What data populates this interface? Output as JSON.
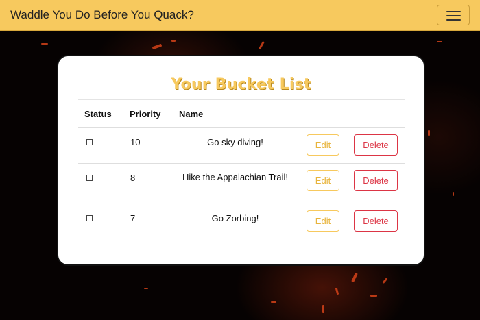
{
  "navbar": {
    "brand": "Waddle You Do Before You Quack?",
    "toggle_icon": "hamburger-menu-icon"
  },
  "card": {
    "title": "Your Bucket List",
    "columns": [
      "Status",
      "Priority",
      "Name"
    ],
    "rows": [
      {
        "status_checked": false,
        "priority": "10",
        "name": "Go sky diving!",
        "edit_label": "Edit",
        "delete_label": "Delete"
      },
      {
        "status_checked": false,
        "priority": "8",
        "name": "Hike the Appalachian Trail!",
        "edit_label": "Edit",
        "delete_label": "Delete"
      },
      {
        "status_checked": false,
        "priority": "7",
        "name": "Go Zorbing!",
        "edit_label": "Edit",
        "delete_label": "Delete"
      }
    ]
  },
  "colors": {
    "navbar": "#f7c95e",
    "title": "#f7c95e",
    "edit": "#f7c95e",
    "delete": "#dc3545",
    "background": "#060202"
  }
}
